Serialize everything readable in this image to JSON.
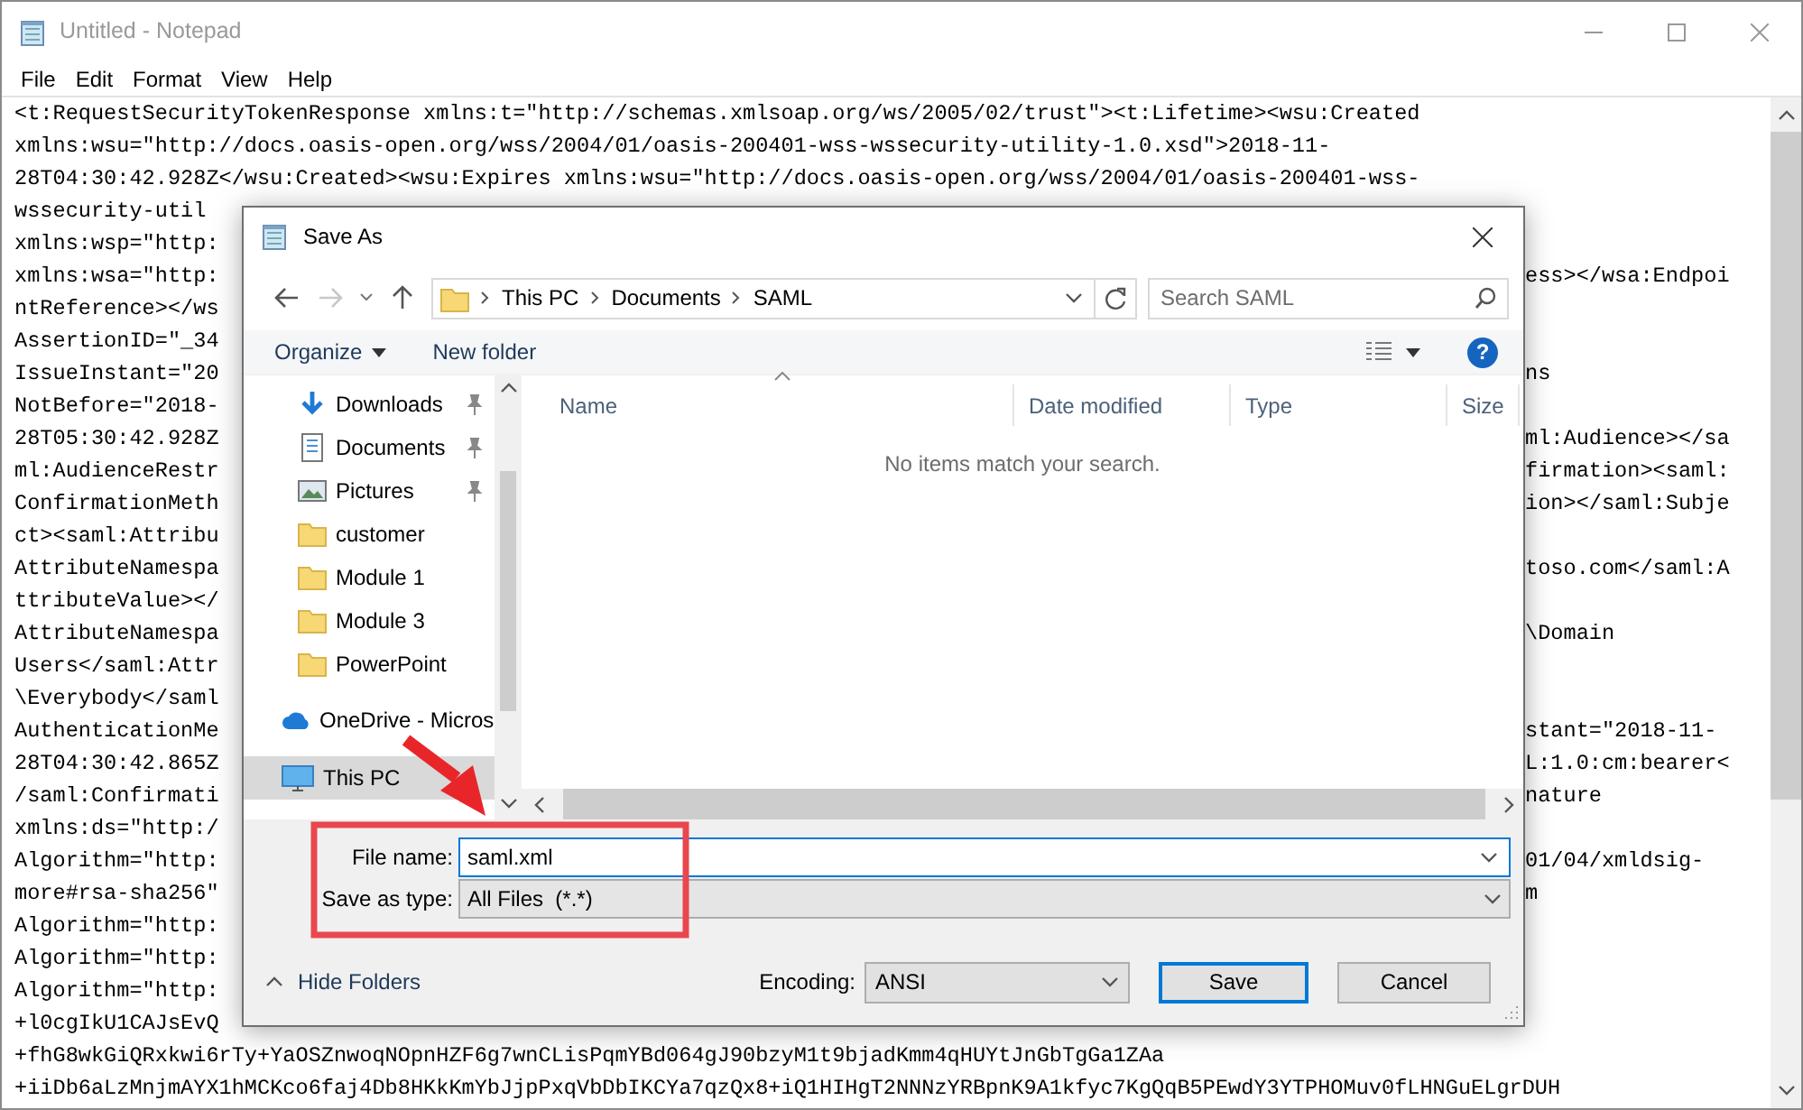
{
  "notepad": {
    "title": "Untitled - Notepad",
    "menu": [
      "File",
      "Edit",
      "Format",
      "View",
      "Help"
    ],
    "lines": [
      {
        "kind": "full",
        "text": "<t:RequestSecurityTokenResponse xmlns:t=\"http://schemas.xmlsoap.org/ws/2005/02/trust\"><t:Lifetime><wsu:Created"
      },
      {
        "kind": "full",
        "text": "xmlns:wsu=\"http://docs.oasis-open.org/wss/2004/01/oasis-200401-wss-wssecurity-utility-1.0.xsd\">2018-11-"
      },
      {
        "kind": "full",
        "text": "28T04:30:42.928Z</wsu:Created><wsu:Expires xmlns:wsu=\"http://docs.oasis-open.org/wss/2004/01/oasis-200401-wss-"
      },
      {
        "kind": "split",
        "left": "wssecurity-util"
      },
      {
        "kind": "split",
        "left": "xmlns:wsp=\"http:"
      },
      {
        "kind": "split",
        "left": "xmlns:wsa=\"http:",
        "right": "ess></wsa:Endpoi"
      },
      {
        "kind": "split",
        "left": "ntReference></ws"
      },
      {
        "kind": "split",
        "left": "AssertionID=\"_34"
      },
      {
        "kind": "split",
        "left": "IssueInstant=\"20",
        "right": "ns"
      },
      {
        "kind": "split",
        "left": "NotBefore=\"2018-"
      },
      {
        "kind": "split",
        "left": "28T05:30:42.928Z",
        "right": "ml:Audience></sa"
      },
      {
        "kind": "split",
        "left": "ml:AudienceRestr",
        "right": "firmation><saml:"
      },
      {
        "kind": "split",
        "left": "ConfirmationMeth",
        "right": "ion></saml:Subje"
      },
      {
        "kind": "split",
        "left": "ct><saml:Attribu"
      },
      {
        "kind": "split",
        "left": "AttributeNamespa",
        "right": "toso.com</saml:A"
      },
      {
        "kind": "split",
        "left": "ttributeValue></"
      },
      {
        "kind": "split",
        "left": "AttributeNamespa",
        "right": "\\Domain"
      },
      {
        "kind": "split",
        "left": "Users</saml:Attr"
      },
      {
        "kind": "split",
        "left": "\\Everybody</saml"
      },
      {
        "kind": "split",
        "left": "AuthenticationMe",
        "right": "stant=\"2018-11-"
      },
      {
        "kind": "split",
        "left": "28T04:30:42.865Z",
        "right": "L:1.0:cm:bearer<"
      },
      {
        "kind": "split",
        "left": "/saml:Confirmati",
        "right": "nature"
      },
      {
        "kind": "split",
        "left": "xmlns:ds=\"http:/"
      },
      {
        "kind": "split",
        "left": "Algorithm=\"http:",
        "right": "01/04/xmldsig-"
      },
      {
        "kind": "split",
        "left": "more#rsa-sha256\"",
        "right": "m"
      },
      {
        "kind": "split",
        "left": "Algorithm=\"http:"
      },
      {
        "kind": "split",
        "left": "Algorithm=\"http:"
      },
      {
        "kind": "split",
        "left": "Algorithm=\"http:"
      },
      {
        "kind": "split",
        "left": "+l0cgIkU1CAJsEvQ"
      },
      {
        "kind": "full",
        "text": "+fhG8wkGiQRxkwi6rTy+YaOSZnwoqNOpnHZF6g7wnCLisPqmYBd064gJ90bzyM1t9bjadKmm4qHUYtJnGbTgGa1ZAa"
      },
      {
        "kind": "full",
        "text": "+iiDb6aLzMnjmAYX1hMCKco6faj4Db8HKkKmYbJjpPxqVbDbIKCYa7qzQx8+iQ1HIHgT2NNNzYRBpnK9A1kfyc7KgQqB5PEwdY3YTPHOMuv0fLHNGuELgrDUH"
      }
    ]
  },
  "save_dialog": {
    "title": "Save As",
    "breadcrumb": [
      "This PC",
      "Documents",
      "SAML"
    ],
    "search": {
      "placeholder": "Search SAML"
    },
    "toolbar": [
      {
        "label": "Organize",
        "dropdown": true
      },
      {
        "label": "New folder",
        "dropdown": false
      }
    ],
    "help": "?",
    "nav_pane": {
      "quick_access": [
        {
          "label": "Downloads",
          "kind": "download",
          "pinned": true,
          "selected": false
        },
        {
          "label": "Documents",
          "kind": "document",
          "pinned": true,
          "selected": false
        },
        {
          "label": "Pictures",
          "kind": "picture",
          "pinned": true,
          "selected": false
        },
        {
          "label": "customer",
          "kind": "folder",
          "pinned": false,
          "selected": false
        },
        {
          "label": "Module 1",
          "kind": "folder",
          "pinned": false,
          "selected": false
        },
        {
          "label": "Module 3",
          "kind": "folder",
          "pinned": false,
          "selected": false
        },
        {
          "label": "PowerPoint",
          "kind": "folder",
          "pinned": false,
          "selected": false
        }
      ],
      "locations": [
        {
          "label": "OneDrive - Micros",
          "kind": "cloud",
          "selected": false
        },
        {
          "label": "This PC",
          "kind": "computer",
          "selected": true
        }
      ]
    },
    "columns": [
      {
        "label": "Name",
        "sorted": true
      },
      {
        "label": "Date modified",
        "sorted": false
      },
      {
        "label": "Type",
        "sorted": false
      },
      {
        "label": "Size",
        "sorted": false
      }
    ],
    "empty_message": "No items match your search.",
    "file_name": {
      "label": "File name:",
      "value": "saml.xml"
    },
    "save_as_type": {
      "label": "Save as type:",
      "value": "All Files  (*.*)"
    },
    "hide_folders": "Hide Folders",
    "encoding": {
      "label": "Encoding:",
      "value": "ANSI"
    },
    "buttons": [
      {
        "label": "Save",
        "default": true
      },
      {
        "label": "Cancel",
        "default": false
      }
    ]
  }
}
